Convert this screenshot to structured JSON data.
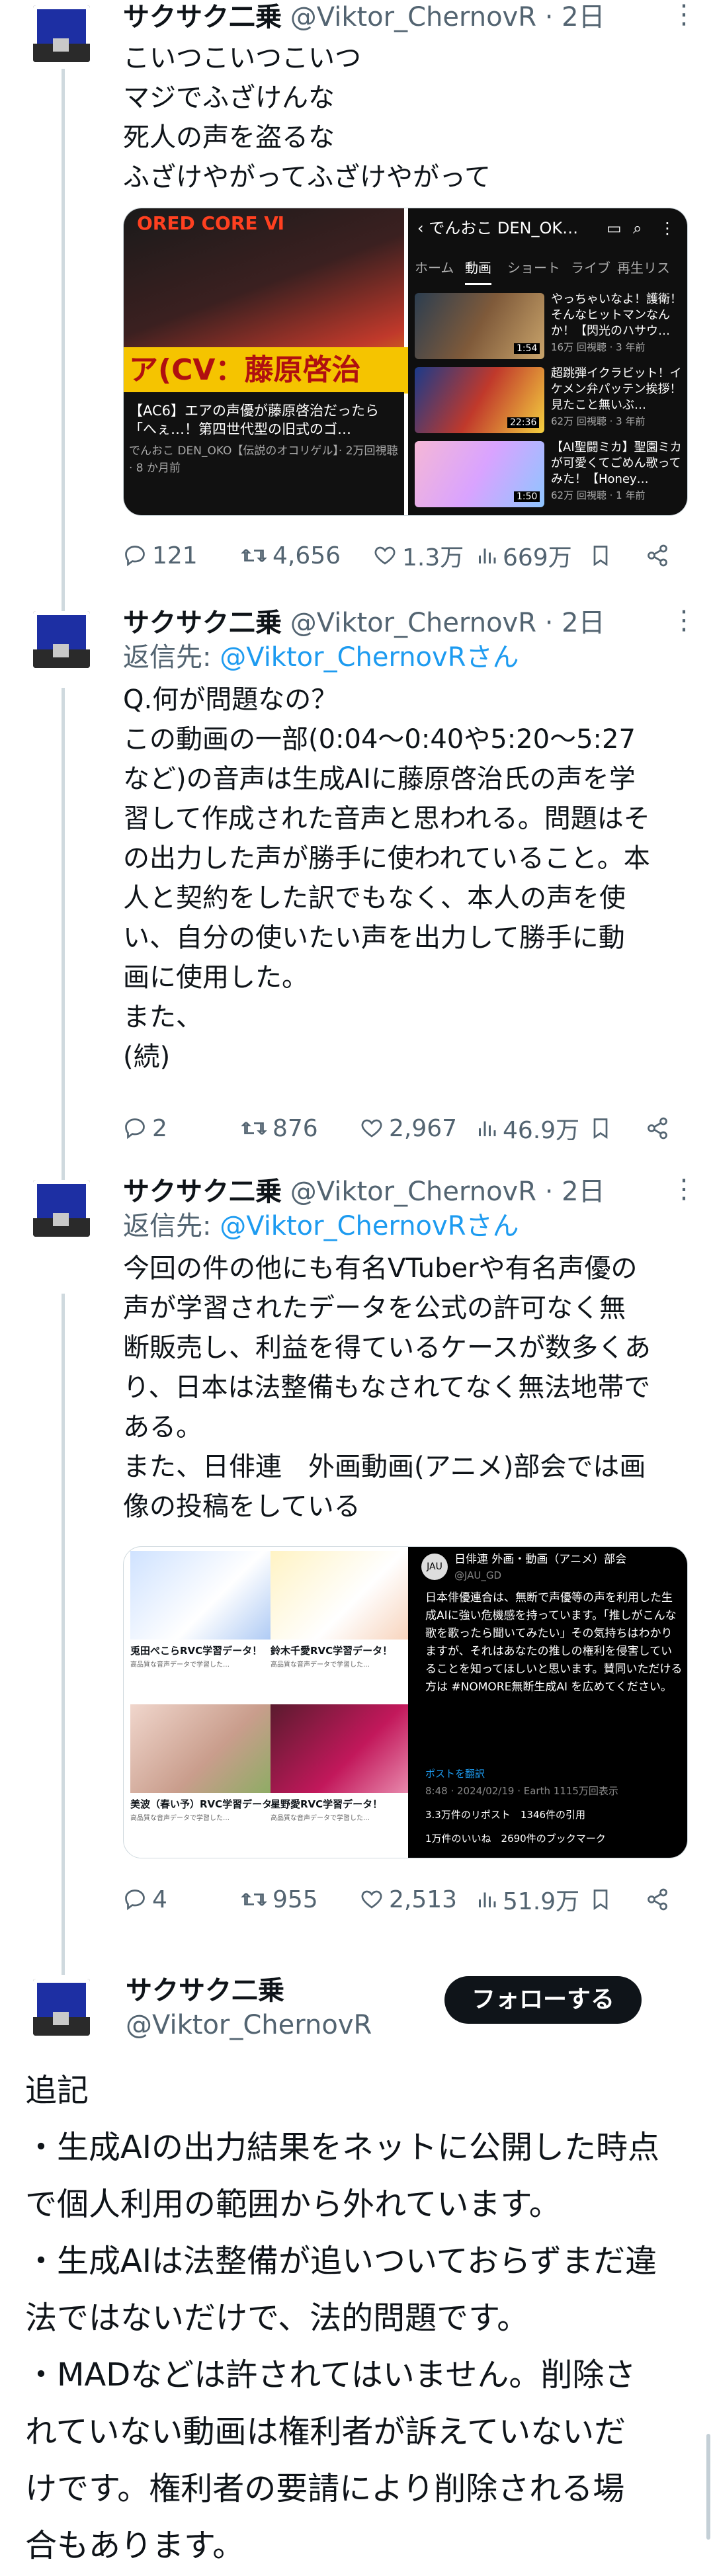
{
  "author": {
    "name": "サクサク二乗",
    "handle": "@Viktor_ChernovR"
  },
  "tweets": [
    {
      "time": "· 2日",
      "lines": [
        "こいつこいつこいつ",
        "マジでふざけんな",
        "死人の声を盗るな",
        "ふざけやがってふざけやがって"
      ],
      "media_left": {
        "top_text": "ORED CORE Ⅵ",
        "banner": "ア(CV：藤原啓治",
        "caption": "【AC6】エアの声優が藤原啓治だったら「へぇ…！第四世代型の旧式のゴ…",
        "channel": "でんおこ DEN_OKO【伝説のオコリゲル】· 2万回視聴 · 8 か月前"
      },
      "media_right": {
        "header": "でんおこ DEN_OK…",
        "tabs": [
          "ホーム",
          "動画",
          "ショート",
          "ライブ",
          "再生リス"
        ],
        "videos": [
          {
            "title": "やっちゃいなよ！護衛！そんなヒットマンなんか！【閃光のハサウ…",
            "meta": "16万 回視聴 · 3 年前",
            "duration": "1:54"
          },
          {
            "title": "超跳弾イクラビット！イケメン弁パッテン挨拶！見たこと無いぶ…",
            "meta": "62万 回視聴 · 3 年前",
            "duration": "22:36"
          },
          {
            "title": "【AI聖闘ミカ】聖園ミカが可愛くてごめん歌ってみた！【Honey…",
            "meta": "62万 回視聴 · 1 年前",
            "duration": "1:50"
          }
        ]
      },
      "stats": {
        "replies": "121",
        "retweets": "4,656",
        "likes": "1.3万",
        "views": "669万"
      }
    },
    {
      "time": "· 2日",
      "reply_prefix": "返信先: ",
      "reply_to": "@Viktor_ChernovRさん",
      "lines": [
        "Q.何が問題なの？",
        "この動画の一部(0:04〜0:40や5:20〜5:27",
        "など)の音声は生成AIに藤原啓治氏の声を学",
        "習して作成された音声と思われる。問題はそ",
        "の出力した声が勝手に使われていること。本",
        "人と契約をした訳でもなく、本人の声を使",
        "い、自分の使いたい声を出力して勝手に動",
        "画に使用した。",
        "また、",
        "(続)"
      ],
      "stats": {
        "replies": "2",
        "retweets": "876",
        "likes": "2,967",
        "views": "46.9万"
      }
    },
    {
      "time": "· 2日",
      "reply_prefix": "返信先: ",
      "reply_to": "@Viktor_ChernovRさん",
      "lines": [
        "今回の件の他にも有名VTuberや有名声優の",
        "声が学習されたデータを公式の許可なく無",
        "断販売し、利益を得ているケースが数多くあ",
        "り、日本は法整備もなされてなく無法地帯で",
        "ある。",
        "また、日俳連　外画動画(アニメ)部会では画",
        "像の投稿をしている"
      ],
      "cards": [
        {
          "title": "兎田ぺこらRVC学習データ！",
          "desc": "高品質な音声データで学習した…",
          "img": "#dfe9f7"
        },
        {
          "title": "鈴木千愛RVC学習データ！",
          "desc": "高品質な音声データで学習した…",
          "img": "#f7efd9"
        },
        {
          "title": "美波（春い予）RVC学習データ！",
          "desc": "高品質な音声データで学習した…",
          "img": "#e7d9d4"
        },
        {
          "title": "星野愛RVC学習データ！",
          "desc": "高品質な音声データで学習した…",
          "img": "#5a1b2e"
        }
      ],
      "x_post": {
        "account": "日俳連 外画・動画（アニメ）部会",
        "handle": "@JAU_GD",
        "text": "日本俳優連合は、無断で声優等の声を利用した生成AIに強い危機感を持っています。「推しがこんな歌を歌ったら聞いてみたい」その気持ちはわかりますが、それはあなたの推しの権利を侵害していることを知ってほしいと思います。賛同いただける方は #NOMORE無断生成AI を広めてください。",
        "translate": "ポストを翻訳",
        "meta": "8:48 · 2024/02/19 · Earth 1115万回表示",
        "stats1": "3.3万件のリポスト　1346件の引用",
        "stats2": "1万件のいいね　2690件のブックマーク"
      },
      "stats": {
        "replies": "4",
        "retweets": "955",
        "likes": "2,513",
        "views": "51.9万"
      }
    }
  ],
  "follow_label": "フォローする",
  "final_lines": [
    "追記",
    "・生成AIの出力結果をネットに公開した時点",
    "で個人利用の範囲から外れています。",
    "・生成AIは法整備が追いついておらずまだ違",
    "法ではないだけで、法的問題です。",
    "・MADなどは許されてはいません。削除さ",
    "れていない動画は権利者が訴えていないだ",
    "けです。権利者の要請により削除される場",
    "合もあります。"
  ],
  "colors": {
    "link": "#1d9bf0",
    "muted": "#536471",
    "line": "#cfd9de"
  }
}
